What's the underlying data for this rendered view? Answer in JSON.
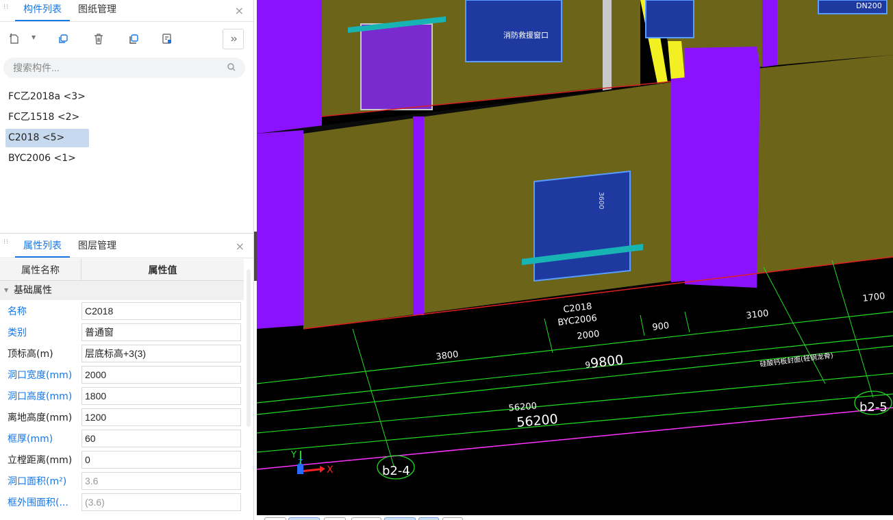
{
  "component_panel": {
    "tabs": [
      {
        "label": "构件列表"
      },
      {
        "label": "图纸管理"
      }
    ],
    "close": "×",
    "search_placeholder": "搜索构件...",
    "items": [
      {
        "label": "FC乙2018a <3>"
      },
      {
        "label": "FC乙1518 <2>"
      },
      {
        "label": "C2018 <5>"
      },
      {
        "label": "BYC2006 <1>"
      }
    ],
    "selected_index": 2,
    "toolbar_icons": [
      "new-component-icon",
      "copy-icon",
      "delete-icon",
      "copy-to-floor-icon",
      "layer-icon",
      "more-icon"
    ]
  },
  "property_panel": {
    "tabs": [
      {
        "label": "属性列表"
      },
      {
        "label": "图层管理"
      }
    ],
    "close": "×",
    "header": {
      "name": "属性名称",
      "value": "属性值"
    },
    "group": "基础属性",
    "rows": [
      {
        "key": "名称",
        "value": "C2018",
        "blue": true
      },
      {
        "key": "类别",
        "value": "普通窗",
        "blue": true
      },
      {
        "key": "顶标高(m)",
        "value": "层底标高+3(3)",
        "blue": false
      },
      {
        "key": "洞口宽度(mm)",
        "value": "2000",
        "blue": true
      },
      {
        "key": "洞口高度(mm)",
        "value": "1800",
        "blue": true
      },
      {
        "key": "离地高度(mm)",
        "value": "1200",
        "blue": false
      },
      {
        "key": "框厚(mm)",
        "value": "60",
        "blue": true
      },
      {
        "key": "立樘距离(mm)",
        "value": "0",
        "blue": false
      },
      {
        "key": "洞口面积(m²)",
        "value": "3.6",
        "blue": true,
        "readonly": true
      },
      {
        "key": "框外围面积(...",
        "value": "(3.6)",
        "blue": true,
        "readonly": true
      }
    ]
  },
  "viewport": {
    "labels": {
      "window_name_1": "C2018",
      "window_name_2": "BYC2006",
      "dim_2000": "2000",
      "dim_900": "900",
      "dim_3100": "3100",
      "dim_1700": "1700",
      "dim_3800": "3800",
      "dim_9800": "9800",
      "dim_9800_small": "9",
      "dim_56200_small": "56200",
      "dim_56200": "56200",
      "note": "硅酸钙板封面(轻钢龙骨)",
      "axis_left": "b2-4",
      "axis_right": "b2-5",
      "axis_x": "X",
      "axis_y": "Y",
      "axis_z": "Z",
      "window_top_label": "消防救援窗口",
      "window_mark": "3600",
      "top_right": "DN200"
    },
    "colors": {
      "wall": "#6b6419",
      "column": "#8a12ff",
      "window_glass": "#1e3aa0",
      "sill": "#18b4b4",
      "dim_line": "#22dd22",
      "red_line": "#ff2222",
      "magenta_line": "#ff33ff"
    }
  }
}
